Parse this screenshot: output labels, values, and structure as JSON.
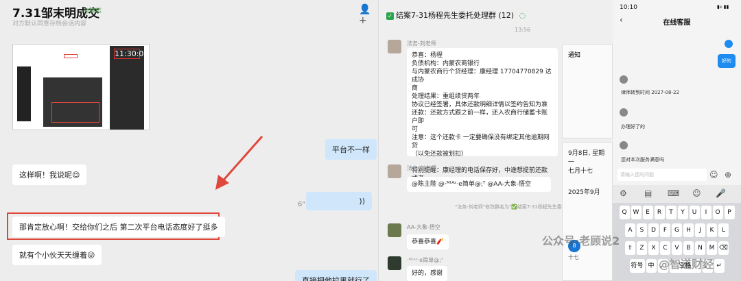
{
  "left": {
    "title": "7.31邹末明成交",
    "tag": "@微信",
    "subtitle": "对方默认同意存档会话内容",
    "screenshot_time": "11:30:03",
    "messages": [
      {
        "text": "平台不一样",
        "side": "right"
      },
      {
        "text": "这样啊！我说呢😌",
        "side": "left"
      },
      {
        "text": "6\"",
        "side": "right",
        "voice": true
      },
      {
        "text": "那肯定放心啊！交给你们之后 第二次平台电话态度好了挺多",
        "side": "left",
        "highlighted": true
      },
      {
        "text": "就有个小伙天天缠着😜",
        "side": "left"
      },
      {
        "text": "直接把他拉黑就行了",
        "side": "right"
      }
    ]
  },
  "middle": {
    "header": "结案7-31杨程先生委托处理群 (12)",
    "time": "13:56",
    "msg1": {
      "sender": "法务-刘老师",
      "lines": [
        "恭喜：杨程",
        "负债机构：内蒙农商银行",
        "与内蒙农商行个贷经理：康经理 17704770829 达成协",
        "商",
        "处理结果：重组续贷两年",
        "协议已经签署，具体还款明细详情以签约告知为准",
        "还款：还款方式跟之前一样，还入农商行储蓄卡账户即",
        "可",
        "注意：这个还款卡 一定要确保没有绑定其他逾期网贷",
        "（以免还款被划扣）",
        "",
        "特别提醒：康经理的电话保存好，中途想提前还款或者",
        "有什么问题都可以联系他咨询"
      ]
    },
    "msg2": {
      "sender": "法务-刘老师",
      "text": "@陈主陛 @·ᴹᵗᴬᶻ·e简单@;ᵀ @AA-大象-悟空"
    },
    "system": "\"法务-刘老师\"修改群名为\"✅结案7-31杨程先生委托处理群\"",
    "msg3": {
      "sender": "AA-大象-悟空",
      "text": "恭喜恭喜🧨"
    },
    "msg4": {
      "sender": "·ᴹᵗᴬᶻ·e简单@;ᵀ",
      "text": "好的，感谢"
    },
    "notice_title": "通知",
    "calendar": {
      "date": "9月8日, 星期一",
      "lunar": "七月十七",
      "month": "2025年9月",
      "today": "8",
      "today_lunar": "十七"
    }
  },
  "right": {
    "status_time": "10:10",
    "status_icons": "▮ᵢₗₗ ▮▮",
    "title": "在线客服",
    "msg_blue": "好的",
    "items": [
      "律师转到时间 2027-08-22",
      "办理好了的",
      "您对本次服务满意吗"
    ],
    "input_placeholder": "请输入您的问题",
    "keys_row1": [
      "Q",
      "W",
      "E",
      "R",
      "T",
      "Y",
      "U",
      "I",
      "O",
      "P"
    ],
    "keys_row2": [
      "A",
      "S",
      "D",
      "F",
      "G",
      "H",
      "J",
      "K",
      "L"
    ],
    "keys_row3": [
      "⇧",
      "Z",
      "X",
      "C",
      "V",
      "B",
      "N",
      "M",
      "⌫"
    ],
    "keys_row4": [
      "符号",
      "中",
      "，",
      "空格",
      "。",
      "↵"
    ]
  },
  "watermarks": [
    "公众号·老顾说2",
    "@智道财经"
  ]
}
